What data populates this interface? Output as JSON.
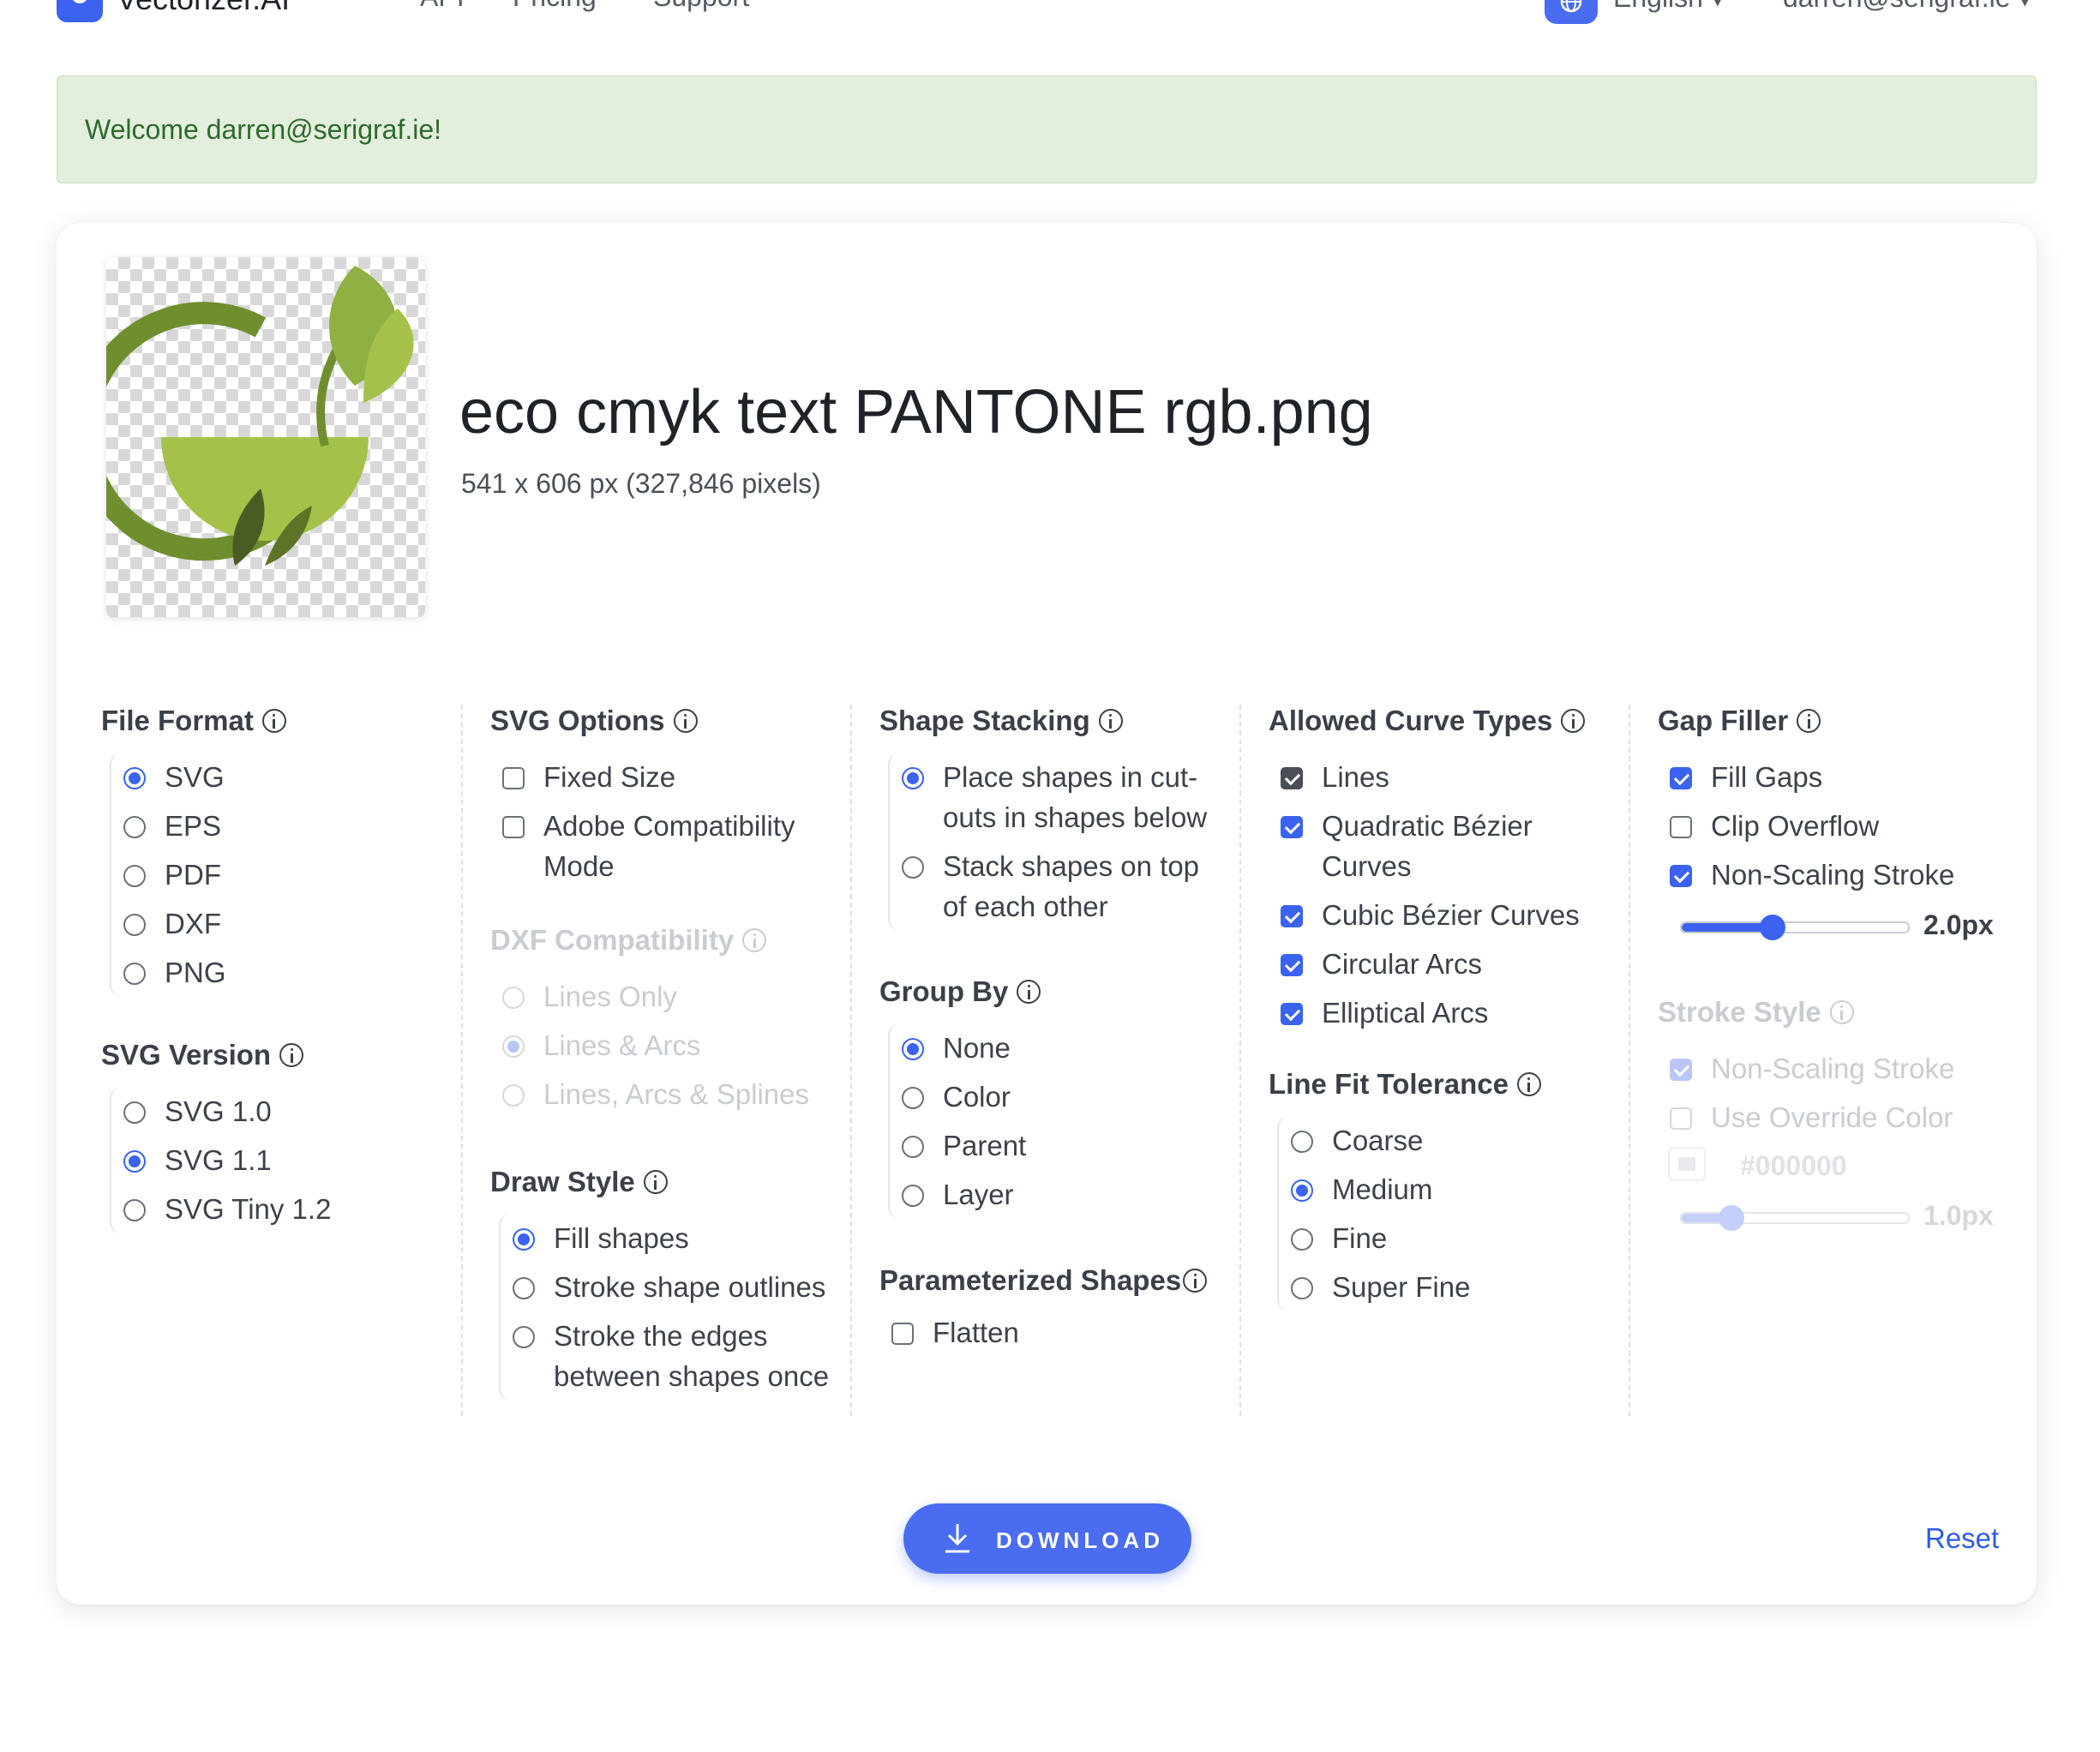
{
  "nav": {
    "brand": "Vectorizer.AI",
    "links": [
      "API",
      "Pricing",
      "Support"
    ],
    "language": "English ▾",
    "user": "darren@serigraf.ie ▾"
  },
  "alert": {
    "message": "Welcome darren@serigraf.ie!"
  },
  "file": {
    "name": "eco cmyk text PANTONE rgb.png",
    "dimensions": "541 x 606 px (327,846 pixels)"
  },
  "options": {
    "file_format": {
      "title": "File Format",
      "items": [
        "SVG",
        "EPS",
        "PDF",
        "DXF",
        "PNG"
      ],
      "selected": "SVG"
    },
    "svg_version": {
      "title": "SVG Version",
      "items": [
        "SVG 1.0",
        "SVG 1.1",
        "SVG Tiny 1.2"
      ],
      "selected": "SVG 1.1"
    },
    "svg_options": {
      "title": "SVG Options",
      "items": [
        "Fixed Size",
        "Adobe Compatibility Mode"
      ],
      "checked": [
        false,
        false
      ]
    },
    "dxf_compat": {
      "title": "DXF Compatibility",
      "items": [
        "Lines Only",
        "Lines & Arcs",
        "Lines, Arcs & Splines"
      ],
      "selected": "Lines & Arcs",
      "disabled": true
    },
    "draw_style": {
      "title": "Draw Style",
      "items": [
        "Fill shapes",
        "Stroke shape outlines",
        "Stroke the edges between shapes once"
      ],
      "selected": "Fill shapes"
    },
    "shape_stacking": {
      "title": "Shape Stacking",
      "items": [
        "Place shapes in cut-outs in shapes below",
        "Stack shapes on top of each other"
      ],
      "selected": "Place shapes in cut-outs in shapes below"
    },
    "group_by": {
      "title": "Group By",
      "items": [
        "None",
        "Color",
        "Parent",
        "Layer"
      ],
      "selected": "None"
    },
    "parameterized": {
      "title": "Parameterized Shapes",
      "items": [
        "Flatten"
      ],
      "checked": [
        false
      ]
    },
    "curve_types": {
      "title": "Allowed Curve Types",
      "items": [
        "Lines",
        "Quadratic Bézier Curves",
        "Cubic Bézier Curves",
        "Circular Arcs",
        "Elliptical Arcs"
      ],
      "checked": [
        true,
        true,
        true,
        true,
        true
      ]
    },
    "line_fit": {
      "title": "Line Fit Tolerance",
      "items": [
        "Coarse",
        "Medium",
        "Fine",
        "Super Fine"
      ],
      "selected": "Medium"
    },
    "gap_filler": {
      "title": "Gap Filler",
      "items": [
        "Fill Gaps",
        "Clip Overflow",
        "Non-Scaling Stroke"
      ],
      "checked": [
        true,
        false,
        true
      ],
      "stroke_width": "2.0px",
      "stroke_width_fraction": 0.4
    },
    "stroke_style": {
      "title": "Stroke Style",
      "items": [
        "Non-Scaling Stroke",
        "Use Override Color"
      ],
      "checked": [
        true,
        false
      ],
      "color": "#000000",
      "stroke_width": "1.0px",
      "stroke_width_fraction": 0.22,
      "disabled": true
    }
  },
  "footer": {
    "download_label": "DOWNLOAD",
    "reset_label": "Reset"
  },
  "colors": {
    "accent": "#3b63f0",
    "alert_bg": "#e3efdc",
    "alert_text": "#2d6a2d",
    "logo_green": "#6f8f2e",
    "logo_light_green": "#a4c24a"
  }
}
